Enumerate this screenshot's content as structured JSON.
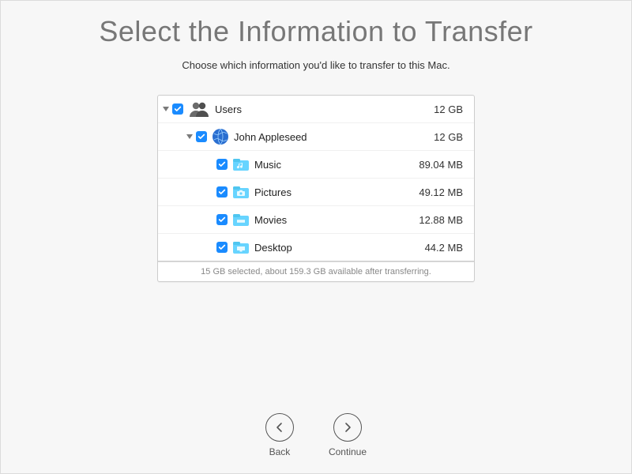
{
  "title": "Select the Information to Transfer",
  "subtitle": "Choose which information you'd like to transfer to this Mac.",
  "tree": {
    "root": {
      "label": "Users",
      "size": "12 GB"
    },
    "user": {
      "label": "John Appleseed",
      "size": "12 GB"
    },
    "items": [
      {
        "label": "Music",
        "size": "89.04 MB"
      },
      {
        "label": "Pictures",
        "size": "49.12 MB"
      },
      {
        "label": "Movies",
        "size": "12.88 MB"
      },
      {
        "label": "Desktop",
        "size": "44.2 MB"
      }
    ]
  },
  "status": "15 GB selected, about 159.3 GB available after transferring.",
  "buttons": {
    "back": "Back",
    "continue": "Continue"
  }
}
